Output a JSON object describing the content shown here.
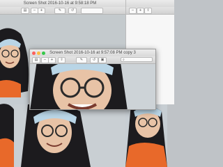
{
  "windows": {
    "back_left": {
      "title": "Screen Shot 2016-10-16 at 9:58:18 PM"
    },
    "back_right": {
      "title": ""
    },
    "front": {
      "title": "Screen Shot 2016-10-16 at 9:57:08 PM copy 3"
    }
  },
  "toolbar": {
    "sidebar_icon": "sidebar-icon",
    "zoom_out_icon": "zoom-out-icon",
    "zoom_in_icon": "zoom-in-icon",
    "share_icon": "share-icon",
    "markup_icon": "pen-icon",
    "rotate_icon": "rotate-icon",
    "toolbox_icon": "toolbox-icon",
    "search_icon": "search-icon"
  },
  "colors": {
    "close": "#fc605c",
    "minimize": "#fdbc40",
    "zoom": "#34c84a",
    "hat_blue": "#b9d5e6",
    "jacket": "#1c1b1e",
    "orange": "#e8692a"
  }
}
